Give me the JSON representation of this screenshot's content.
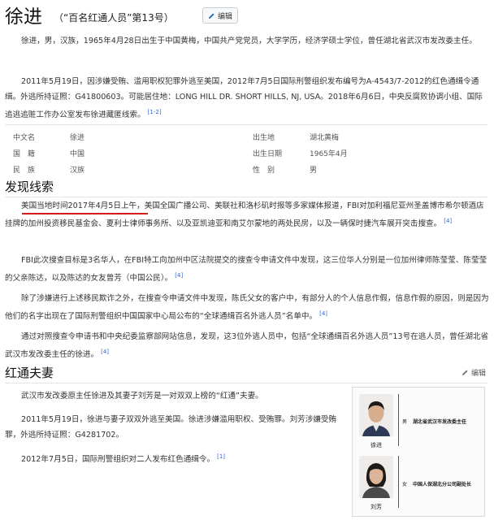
{
  "header": {
    "title": "徐进",
    "subtitle": "（“百名红通人员”第13号）",
    "edit_label": "编辑"
  },
  "intro": {
    "p1": "徐进，男，汉族，1965年4月28日出生于中国黄梅，中国共产党党员，大学学历，经济学硕士学位，曾任湖北省武汉市发改委主任。",
    "p2": "2011年5月19日，因涉嫌受贿、滥用职权犯罪外逃至美国，2012年7月5日国际刑警组织发布编号为A-4543/7-2012的红色通缉令通缉。外逃所持证照：G41800603。可能居住地：LONG HILL DR. SHORT HILLS, NJ, USA。2018年6月6日，中央反腐败协调小组、国际追逃追赃工作办公室发布徐进藏匿线索。",
    "p2_ref": "[1-2]"
  },
  "infobox": {
    "rows": [
      {
        "k1": "中文名",
        "v1": "徐进",
        "k2": "出生地",
        "v2": "湖北黄梅"
      },
      {
        "k1": "国　籍",
        "v1": "中国",
        "k2": "出生日期",
        "v2": "1965年4月"
      },
      {
        "k1": "民　族",
        "v1": "汉族",
        "k2": "性　别",
        "v2": "男"
      }
    ]
  },
  "section1": {
    "heading": "发现线索",
    "p1": "美国当地时间2017年4月5日上午，美国全国广播公司、美联社和洛杉矶时报等多家媒体报道，FBI对加利福尼亚州圣盖博市希尔顿酒店挂牌的加州投资移民基金会、夏利士律师事务所、以及亚凯迪亚和南艾尔蒙地的两处民房，以及一辆保时捷汽车展开突击搜查。",
    "p1_ref": "[4]",
    "p2": "FBI此次搜查目标是3名华人，在FBI特工向加州中区法院提交的搜查令申请文件中发现，这三位华人分别是一位加州律师陈莹莹、陈莹莹的父亲陈达，以及陈达的女友曾芳（中国公民）。",
    "p2_ref": "[4]",
    "p3": "除了涉嫌进行上述移民欺诈之外，在搜查令申请文件中发现，陈氏父女的客户中，有部分人的个人信息作假，信息作假的原因，则是因为他们的名字出现在了国际刑警组织中国国家中心局公布的“全球通缉百名外逃人员”名单中。",
    "p3_ref": "[4]",
    "p4": "通过对照搜查令申请书和中央纪委监察部网站信息，发现，这3位外逃人员中，包括“全球通缉百名外逃人员”13号在逃人员，曾任湖北省武汉市发改委主任的徐进。",
    "p4_ref": "[4]"
  },
  "section2": {
    "heading": "红通夫妻",
    "edit_label": "编辑",
    "p1": "武汉市发改委原主任徐进及其妻子刘芳是一对双双上榜的“红通”夫妻。",
    "p2": "2011年5月19日，徐进与妻子双双外逃至美国。徐进涉嫌滥用职权、受贿罪。刘芳涉嫌受贿罪，外逃所持证照：G4281702。",
    "p3": "2012年7月5日，国际刑警组织对二人发布红色通缉令。",
    "p3_ref": "[1]"
  },
  "figure": {
    "person1_name": "徐进",
    "person1_sex": "男",
    "person1_role": "湖北省武汉市发改委主任",
    "person2_name": "刘芳",
    "person2_sex": "女",
    "person2_role": "中国人保湖北分公司副处长"
  },
  "colors": {
    "link": "#3366cc",
    "accent_red": "#d21b1b",
    "label_gray": "#555555"
  }
}
